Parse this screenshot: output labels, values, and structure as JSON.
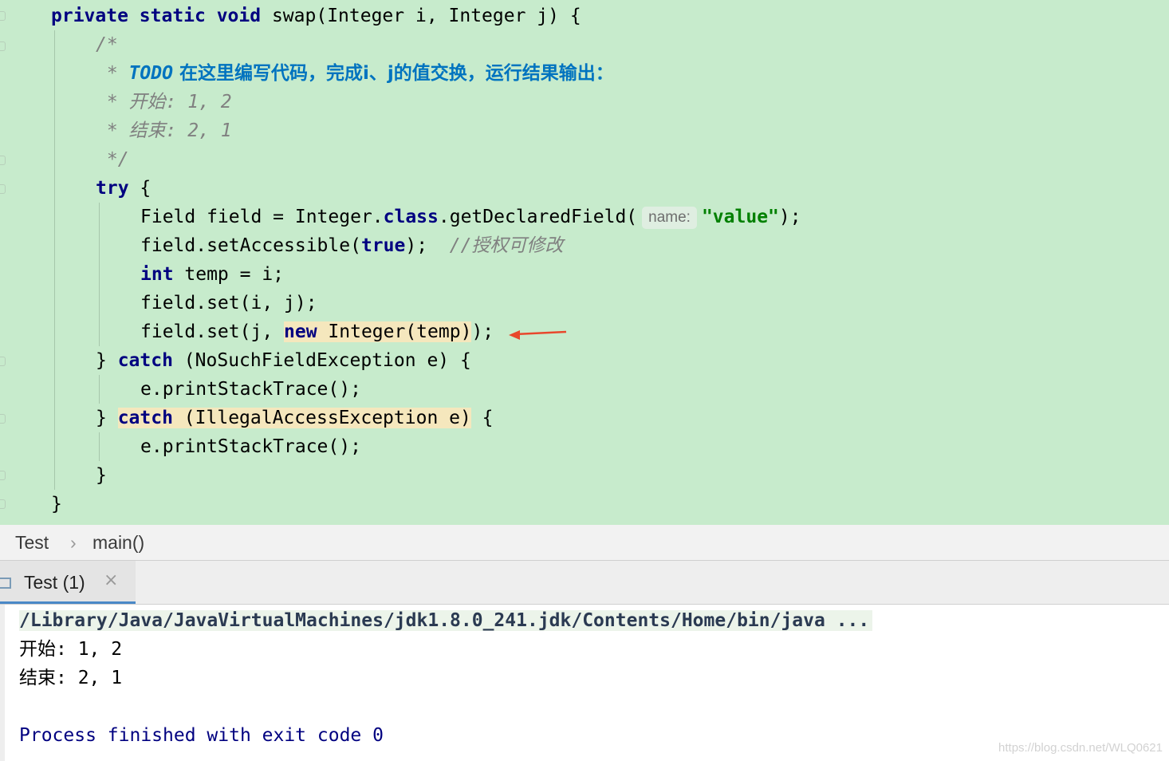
{
  "editor": {
    "lines": {
      "l1_kw": "private static void",
      "l1_rest": " swap(Integer i, Integer j) {",
      "l2": "/*",
      "l3_star": " * ",
      "l3_todo": "TODO",
      "l3_text": " 在这里编写代码，完成i、j的值交换，运行结果输出：",
      "l4": " * 开始: 1, 2",
      "l5": " * 结束: 2, 1",
      "l6": " */",
      "l7_kw": "try",
      "l7_rest": " {",
      "l8_a": "Field field = Integer.",
      "l8_kw": "class",
      "l8_b": ".getDeclaredField(",
      "l8_hint": "name:",
      "l8_str": "\"value\"",
      "l8_c": ");",
      "l9_a": "field.setAccessible(",
      "l9_kw": "true",
      "l9_b": ");  ",
      "l9_comment": "//授权可修改",
      "l10_kw": "int",
      "l10_rest": " temp = i;",
      "l11": "field.set(i, j);",
      "l12_a": "field.set(j, ",
      "l12_kw": "new",
      "l12_hl": " Integer(temp)",
      "l12_b": ");",
      "l13_a": "} ",
      "l13_kw": "catch",
      "l13_rest": " (NoSuchFieldException e) {",
      "l14": "e.printStackTrace();",
      "l15_a": "} ",
      "l15_kw": "catch",
      "l15_hl": " (IllegalAccessException e)",
      "l15_rest": " {",
      "l16": "e.printStackTrace();",
      "l17": "}",
      "l18": "}"
    }
  },
  "breadcrumb": {
    "class": "Test",
    "separator": "›",
    "method": "main()"
  },
  "run_panel": {
    "tab_label": "Test (1)",
    "close_glyph": "×"
  },
  "console": {
    "path": "/Library/Java/JavaVirtualMachines/jdk1.8.0_241.jdk/Contents/Home/bin/java ...",
    "start": "开始: 1, 2",
    "end": "结束: 2, 1",
    "exit": "Process finished with exit code 0"
  },
  "watermark": "https://blog.csdn.net/WLQ0621",
  "colors": {
    "editor_bg": "#c7ebcc",
    "keyword": "#000080",
    "string": "#008000",
    "todo": "#0073bf",
    "arrow": "#e8472c"
  }
}
